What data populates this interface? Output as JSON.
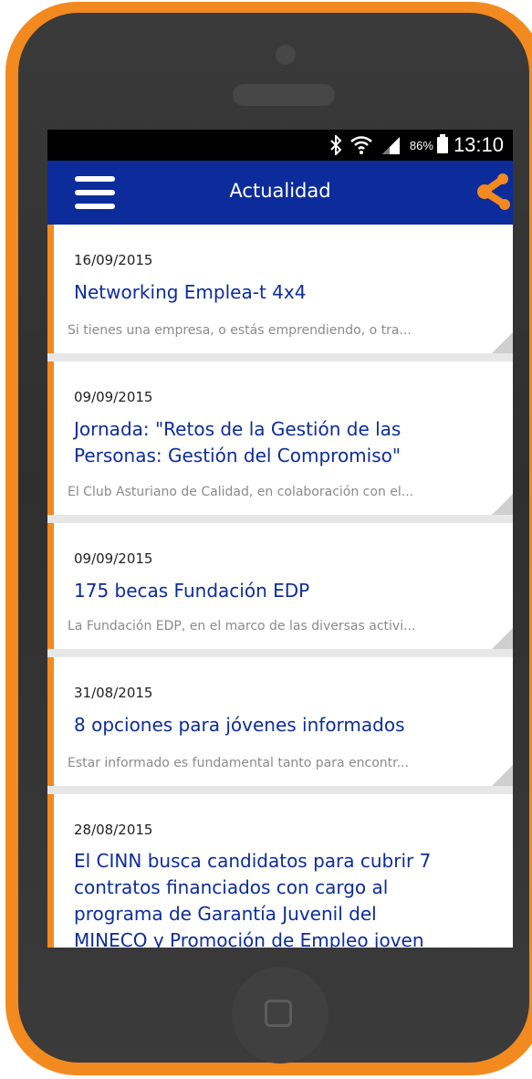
{
  "status_bar": {
    "icons": [
      "bluetooth-icon",
      "wifi-icon",
      "signal-icon",
      "battery-icon"
    ],
    "battery": "86%",
    "time": "13:10"
  },
  "app_bar": {
    "title": "Actualidad",
    "menu_icon": "menu-icon",
    "share_icon": "share-icon",
    "colors": {
      "primary": "#0c2c9b",
      "accent": "#f28a1f",
      "date": "#222222",
      "excerpt": "#8b8b8b"
    }
  },
  "news": [
    {
      "date": "16/09/2015",
      "title": "Networking Emplea-t 4x4",
      "excerpt": "Si tienes una empresa, o estás emprendiendo, o tra..."
    },
    {
      "date": "09/09/2015",
      "title": "Jornada: \"Retos de la Gestión de las Personas: Gestión del Compromiso\"",
      "excerpt": "El Club Asturiano de Calidad, en colaboración con el..."
    },
    {
      "date": "09/09/2015",
      "title": "175 becas Fundación EDP",
      "excerpt": "La Fundación EDP, en el marco de las diversas activi..."
    },
    {
      "date": "31/08/2015",
      "title": "8 opciones para jóvenes informados",
      "excerpt": "Estar informado es fundamental tanto para encontr..."
    },
    {
      "date": "28/08/2015",
      "title": "El CINN busca candidatos para cubrir 7 contratos financiados con cargo al programa de Garantía Juvenil del MINECO y Promoción de Empleo joven"
    }
  ]
}
